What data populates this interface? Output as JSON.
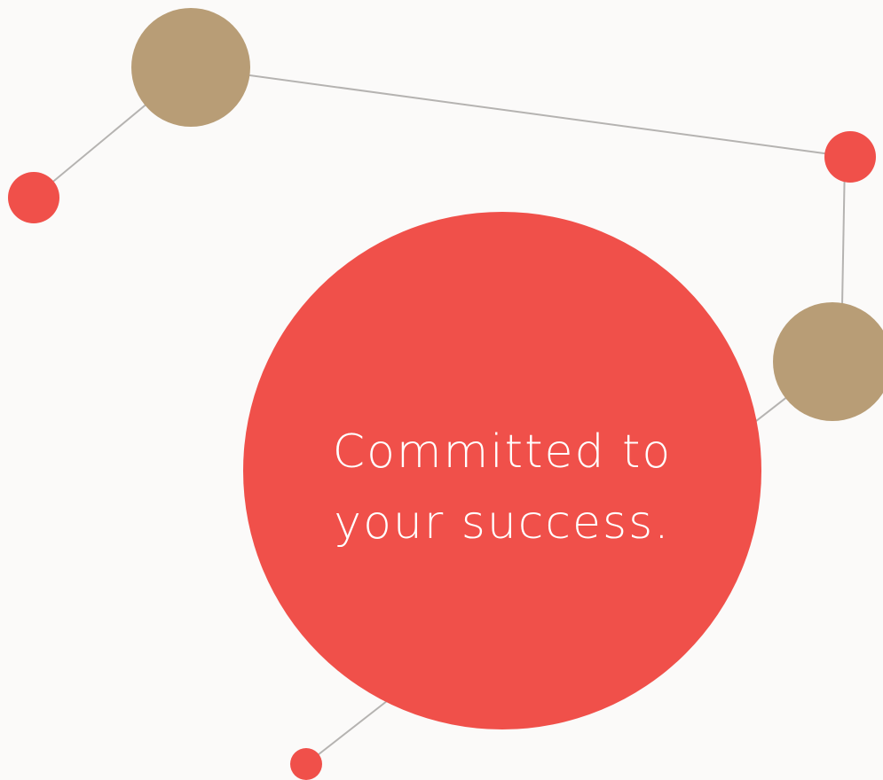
{
  "tagline": {
    "line1": "Committed to",
    "line2": "your success."
  },
  "colors": {
    "background": "#fbfaf9",
    "accent_red": "#f0504a",
    "accent_tan": "#b89d76",
    "connector": "#b5b3b1",
    "text": "#ffffff"
  }
}
